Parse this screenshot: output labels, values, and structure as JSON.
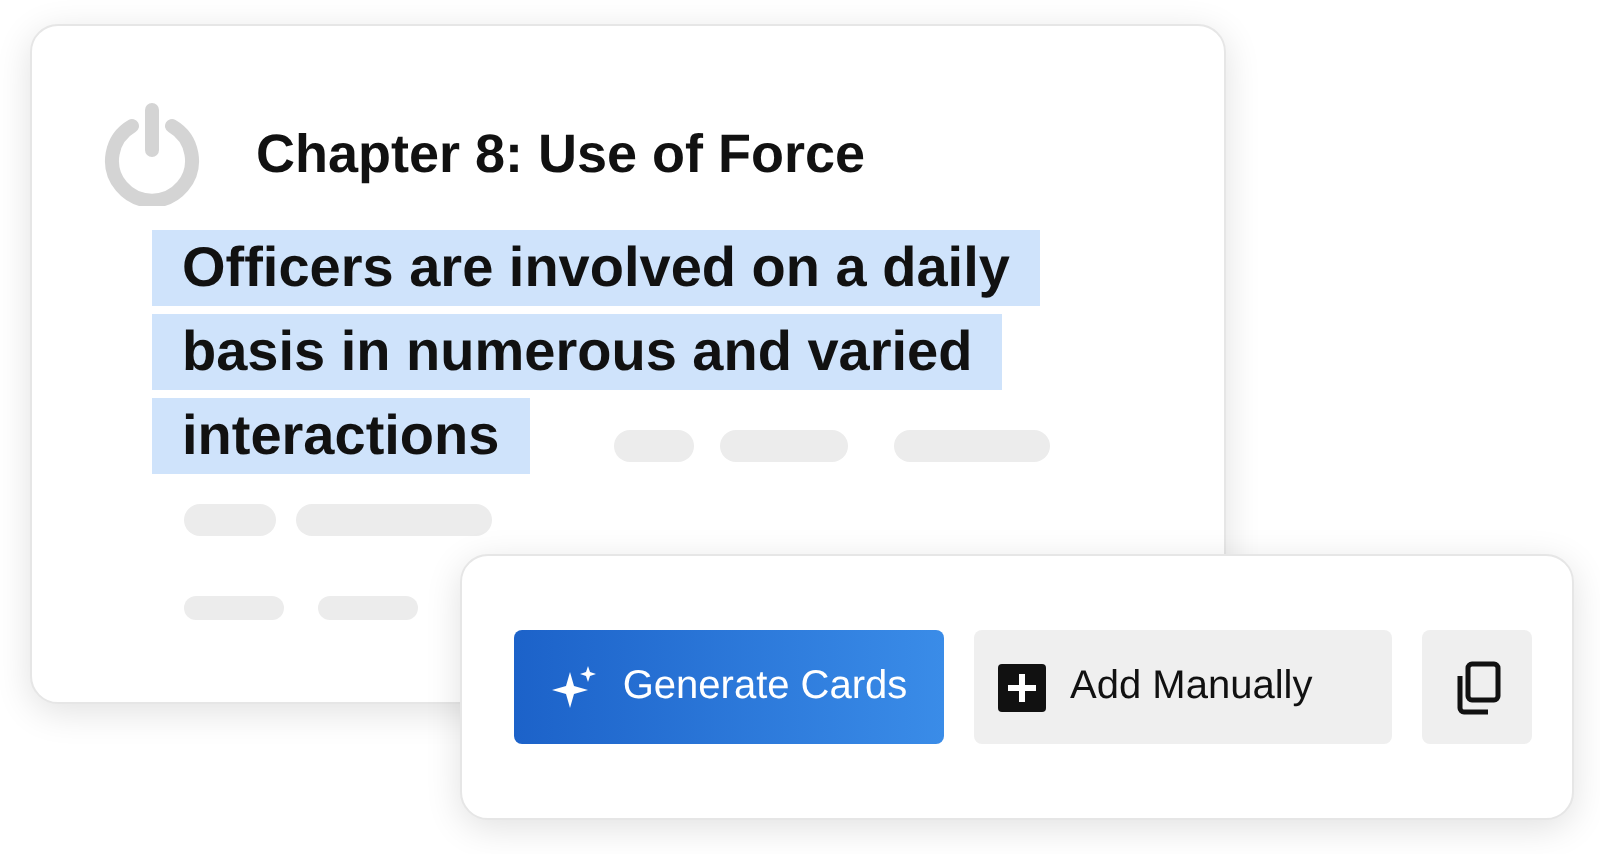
{
  "document_card": {
    "title": "Chapter 8: Use of Force",
    "highlighted_lines": [
      "Officers are involved on a daily",
      "basis in numerous and varied",
      "interactions"
    ]
  },
  "action_bar": {
    "buttons": [
      {
        "kind": "primary",
        "label": "Generate Cards"
      },
      {
        "kind": "secondary",
        "label": "Add Manually"
      },
      {
        "kind": "icon"
      }
    ]
  }
}
